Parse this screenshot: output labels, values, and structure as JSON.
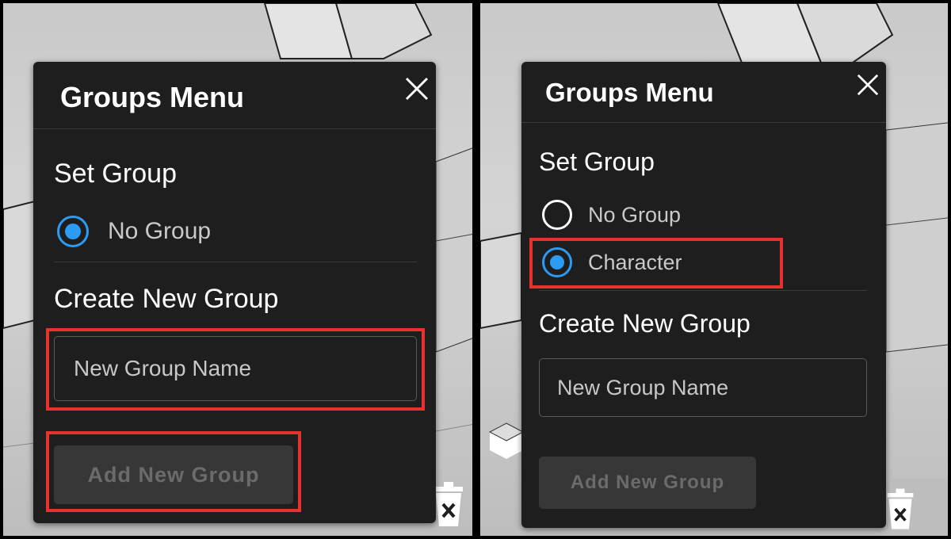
{
  "left_panel": {
    "title": "Groups Menu",
    "set_group_label": "Set Group",
    "group_options": [
      {
        "label": "No Group",
        "selected": true
      }
    ],
    "create_label": "Create New Group",
    "new_group_input": {
      "placeholder": "New Group Name",
      "value": ""
    },
    "add_button_label": "Add New Group",
    "add_button_enabled": false,
    "close_icon": "close-icon"
  },
  "right_panel": {
    "title": "Groups Menu",
    "set_group_label": "Set Group",
    "group_options": [
      {
        "label": "No Group",
        "selected": false
      },
      {
        "label": "Character",
        "selected": true
      }
    ],
    "create_label": "Create New Group",
    "new_group_input": {
      "placeholder": "New Group Name",
      "value": ""
    },
    "add_button_label": "Add New Group",
    "add_button_enabled": false,
    "close_icon": "close-icon"
  },
  "colors": {
    "menu_background": "#1e1e1e",
    "radio_selected": "#2b9bf4",
    "highlight_box": "#e8322f",
    "disabled_button_bg": "#373737",
    "disabled_button_text": "#6b6b6b"
  }
}
